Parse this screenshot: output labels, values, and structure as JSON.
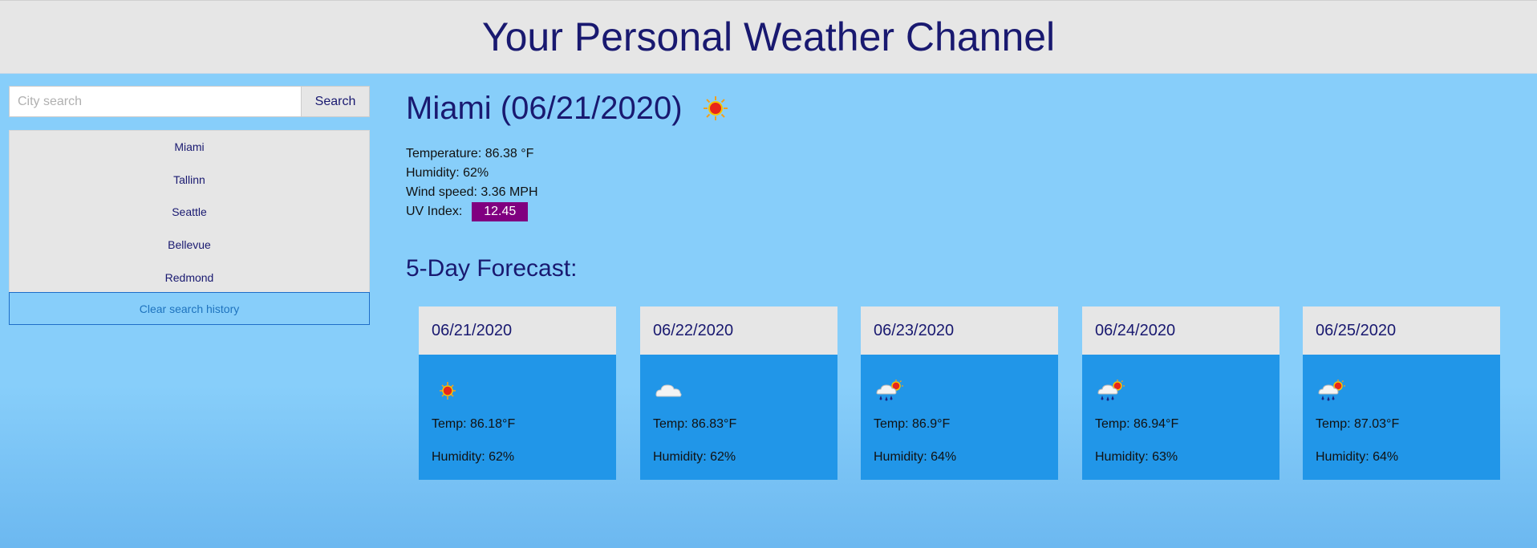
{
  "header": {
    "title": "Your Personal Weather Channel"
  },
  "search": {
    "placeholder": "City search",
    "value": "",
    "button_label": "Search"
  },
  "history": {
    "items": [
      "Miami",
      "Tallinn",
      "Seattle",
      "Bellevue",
      "Redmond"
    ],
    "clear_label": "Clear search history"
  },
  "current": {
    "title": "Miami (06/21/2020)",
    "icon": "sun-icon",
    "temperature": "Temperature: 86.38 °F",
    "humidity": "Humidity: 62%",
    "wind": "Wind speed: 3.36 MPH",
    "uv_label": "UV Index:",
    "uv_value": "12.45",
    "uv_color": "#800080"
  },
  "forecast": {
    "title": "5-Day Forecast:",
    "days": [
      {
        "date": "06/21/2020",
        "icon": "sun-icon",
        "temp": "Temp: 86.18°F",
        "humidity": "Humidity: 62%"
      },
      {
        "date": "06/22/2020",
        "icon": "cloud-icon",
        "temp": "Temp: 86.83°F",
        "humidity": "Humidity: 62%"
      },
      {
        "date": "06/23/2020",
        "icon": "rain-sun-icon",
        "temp": "Temp: 86.9°F",
        "humidity": "Humidity: 64%"
      },
      {
        "date": "06/24/2020",
        "icon": "rain-sun-icon",
        "temp": "Temp: 86.94°F",
        "humidity": "Humidity: 63%"
      },
      {
        "date": "06/25/2020",
        "icon": "rain-sun-icon",
        "temp": "Temp: 87.03°F",
        "humidity": "Humidity: 64%"
      }
    ]
  },
  "colors": {
    "header_bg": "#e6e6e6",
    "title_text": "#191970",
    "page_bg": "#87cefa",
    "card_body": "#2196e8"
  }
}
